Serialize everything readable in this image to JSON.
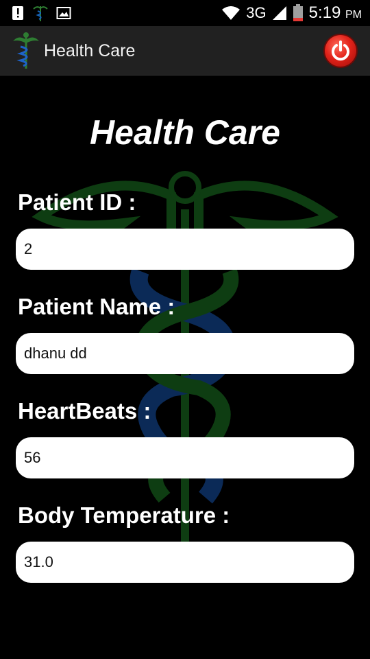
{
  "status_bar": {
    "network": "3G",
    "time": "5:19",
    "ampm": "PM"
  },
  "app_bar": {
    "title": "Health Care"
  },
  "form": {
    "heading": "Health Care",
    "fields": [
      {
        "label": "Patient ID :",
        "value": "2"
      },
      {
        "label": "Patient Name :",
        "value": "dhanu dd"
      },
      {
        "label": "HeartBeats :",
        "value": "56"
      },
      {
        "label": "Body Temperature :",
        "value": "31.0"
      }
    ]
  },
  "colors": {
    "app_bar_bg": "#212121",
    "power_button": "#e2231a",
    "watermark_green": "#0e3d12",
    "watermark_blue": "#0b2a57"
  }
}
